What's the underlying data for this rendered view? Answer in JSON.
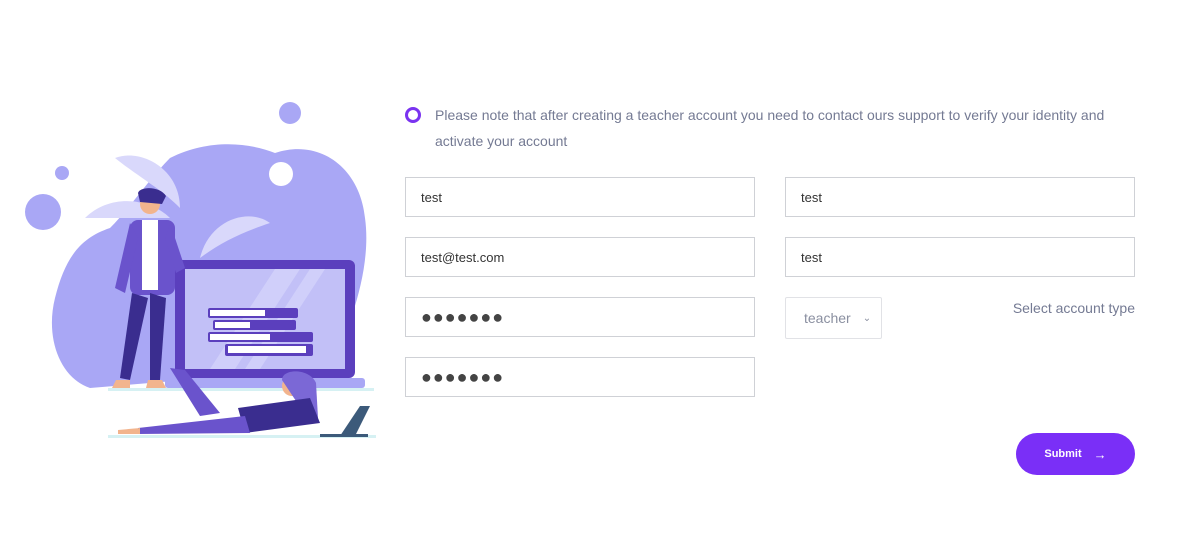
{
  "notice": {
    "icon": "radio-ring-icon",
    "text": "Please note that after creating a teacher account you need to contact ours support to verify your identity and activate your account"
  },
  "form": {
    "first_name": "test",
    "last_name": "test",
    "email": "test@test.com",
    "username": "test",
    "password": "●●●●●●●",
    "confirm_password": "●●●●●●●",
    "account_type": {
      "selected": "teacher",
      "icon": "chevron-down-icon",
      "label": "Select account type"
    },
    "submit_label": "Submit",
    "submit_icon": "arrow-right-icon"
  },
  "colors": {
    "accent": "#7a2ff7",
    "illustration": "#a9a7f5",
    "text_muted": "#747a93"
  }
}
